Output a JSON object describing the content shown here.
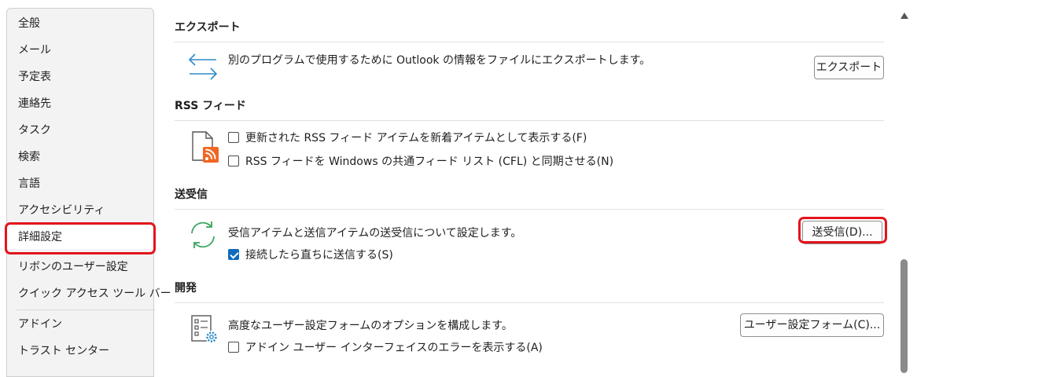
{
  "sidebar": {
    "items": [
      {
        "label": "全般"
      },
      {
        "label": "メール"
      },
      {
        "label": "予定表"
      },
      {
        "label": "連絡先"
      },
      {
        "label": "タスク"
      },
      {
        "label": "検索"
      },
      {
        "label": "言語"
      },
      {
        "label": "アクセシビリティ"
      },
      {
        "label": "詳細設定"
      },
      {
        "label": "リボンのユーザー設定"
      },
      {
        "label": "クイック アクセス ツール バー"
      },
      {
        "label": "アドイン"
      },
      {
        "label": "トラスト センター"
      }
    ],
    "selected": "詳細設定"
  },
  "export": {
    "title": "エクスポート",
    "description": "別のプログラムで使用するために Outlook の情報をファイルにエクスポートします。",
    "button": "エクスポート"
  },
  "rss": {
    "title": "RSS フィード",
    "option1": "更新された RSS フィード アイテムを新着アイテムとして表示する(F)",
    "option2": "RSS フィードを Windows の共通フィード リスト (CFL) と同期させる(N)"
  },
  "sendreceive": {
    "title": "送受信",
    "description": "受信アイテムと送信アイテムの送受信について設定します。",
    "button": "送受信(D)...",
    "option1": "接続したら直ちに送信する(S)",
    "option1_checked": true
  },
  "developer": {
    "title": "開発",
    "description": "高度なユーザー設定フォームのオプションを構成します。",
    "button": "ユーザー設定フォーム(C)...",
    "option1": "アドイン ユーザー インターフェイスのエラーを表示する(A)"
  },
  "colors": {
    "highlight": "#e3141b",
    "checkbox_checked": "#0f6cbd",
    "rss_orange": "#f26522",
    "sync_green": "#3aa55d",
    "export_blue": "#2e8bc9"
  }
}
